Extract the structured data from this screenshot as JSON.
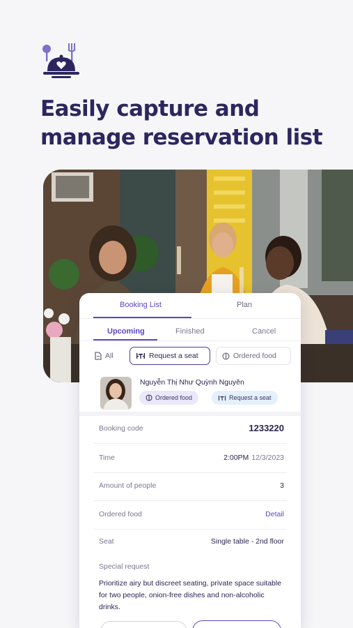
{
  "headline": "Easily capture and manage reservation list",
  "icons": {
    "logo": "restaurant-cloche-icon",
    "all": "document-icon",
    "seat": "table-seat-icon",
    "food": "dish-icon"
  },
  "colors": {
    "brand": "#2c2660",
    "accent": "#5a47c8",
    "food_badge_bg": "#ece8fb",
    "seat_badge_bg": "#e4f0fb"
  },
  "tabs": {
    "booking_list": "Booking List",
    "plan": "Plan"
  },
  "subtabs": {
    "upcoming": "Upcoming",
    "finished": "Finished",
    "cancel": "Cancel"
  },
  "filters": {
    "all": "All",
    "request_seat": "Request a seat",
    "ordered_food": "Ordered food"
  },
  "customer": {
    "name": "Nguyễn Thị Như Quỳnh Nguyên",
    "badge_food": "Ordered food",
    "badge_seat": "Request a seat"
  },
  "details": {
    "booking_code_label": "Booking code",
    "booking_code": "1233220",
    "time_label": "Time",
    "time": "2:00PM",
    "date": "12/3/2023",
    "people_label": "Amount of people",
    "people": "3",
    "food_label": "Ordered food",
    "food_link": "Detail",
    "seat_label": "Seat",
    "seat": "Single table - 2nd floor",
    "special_label": "Special request",
    "special_text": "Prioritize airy but discreet seating, private space suitable for two people, onion-free dishes and non-alcoholic drinks."
  }
}
